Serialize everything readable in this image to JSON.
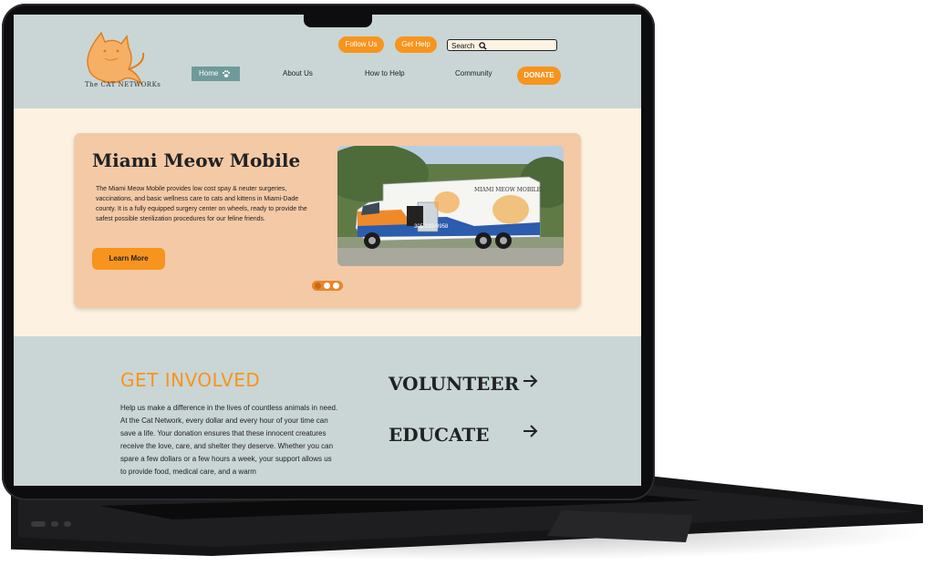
{
  "header": {
    "logo_text": "The CAT NETWORKs",
    "follow_label": "Follow Us",
    "help_label": "Get Help",
    "search_placeholder": "Search",
    "nav": {
      "home": "Home",
      "about": "About Us",
      "how_to_help": "How to Help",
      "community": "Community",
      "donate": "DONATE"
    }
  },
  "hero": {
    "title": "Miami Meow Mobile",
    "body": "The Miami Meow Mobile provides low cost spay & neuter surgeries, vaccinations, and basic wellness care to cats and kittens in Miami-Dade county. It is a fully equipped surgery center on wheels, ready to provide the safest possible sterilization procedures for our feline friends.",
    "learn_label": "Learn More",
    "van_title": "MIAMI MEOW MOBILE",
    "van_phone": "305-233-9958",
    "carousel_dots": 3
  },
  "involved": {
    "title": "GET INVOLVED",
    "body": "Help us make a difference in the lives of countless animals in need. At the Cat Network, every dollar and every hour of your time can save a life. Your donation ensures that these innocent creatures receive the love, care, and shelter they deserve. Whether you can spare a few dollars or a few hours a week, your support allows us to provide food, medical care, and a warm",
    "volunteer_label": "VOLUNTEER",
    "educate_label": "EDUCATE"
  },
  "colors": {
    "accent": "#f7941d",
    "header_bg": "#c9d6d5",
    "hero_bg": "#fdf2e2",
    "card_bg": "#f4c9a6",
    "nav_active": "#6e9a9a"
  }
}
